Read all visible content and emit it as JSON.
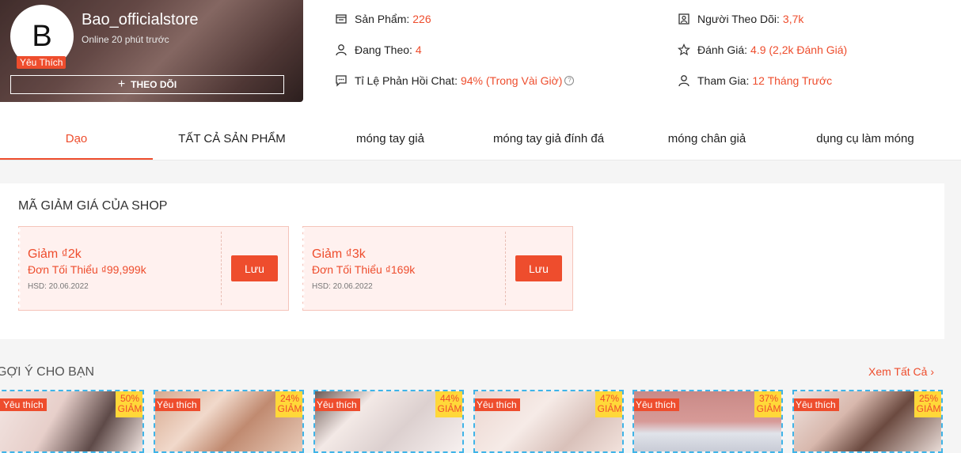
{
  "shop": {
    "avatar_letter": "B",
    "favorite_badge": "Yêu Thích",
    "name": "Bao_officialstore",
    "status": "Online 20 phút trước",
    "follow_label": "THEO DÕI"
  },
  "stats": {
    "products": {
      "label": "Sản Phẩm:",
      "value": "226",
      "icon": "store-icon"
    },
    "followers": {
      "label": "Người Theo Dõi:",
      "value": "3,7k",
      "icon": "followers-icon"
    },
    "following": {
      "label": "Đang Theo:",
      "value": "4",
      "icon": "user-icon"
    },
    "rating": {
      "label": "Đánh Giá:",
      "value": "4.9 (2,2k Đánh Giá)",
      "icon": "star-icon"
    },
    "chat_response": {
      "label": "Tỉ Lệ Phản Hồi Chat:",
      "value": "94% (Trong Vài Giờ)",
      "icon": "chat-icon"
    },
    "joined": {
      "label": "Tham Gia:",
      "value": "12 Tháng Trước",
      "icon": "user-icon"
    }
  },
  "tabs": [
    {
      "label": "Dạo",
      "active": true
    },
    {
      "label": "TẤT CẢ SẢN PHẨM",
      "active": false
    },
    {
      "label": "móng tay giả",
      "active": false
    },
    {
      "label": "móng tay giả đính đá",
      "active": false
    },
    {
      "label": "móng chân giả",
      "active": false
    },
    {
      "label": "dụng cụ làm móng",
      "active": false
    }
  ],
  "vouchers": {
    "title": "MÃ GIẢM GIÁ CỦA SHOP",
    "items": [
      {
        "discount": "Giảm ₫2k",
        "min_order": "Đơn Tối Thiểu ₫99,999k",
        "expiry": "HSD: 20.06.2022",
        "button": "Lưu"
      },
      {
        "discount": "Giảm ₫3k",
        "min_order": "Đơn Tối Thiểu ₫169k",
        "expiry": "HSD: 20.06.2022",
        "button": "Lưu"
      }
    ]
  },
  "recommend": {
    "title": "GỢI Ý CHO BẠN",
    "see_all": "Xem Tất Cả",
    "products": [
      {
        "fav": "Yêu thích",
        "percent": "50%",
        "off": "GIẢM"
      },
      {
        "fav": "Yêu thích",
        "percent": "24%",
        "off": "GIẢM"
      },
      {
        "fav": "Yêu thích",
        "percent": "44%",
        "off": "GIẢM"
      },
      {
        "fav": "Yêu thích",
        "percent": "47%",
        "off": "GIẢM"
      },
      {
        "fav": "Yêu thích",
        "percent": "37%",
        "off": "GIẢM"
      },
      {
        "fav": "Yêu thích",
        "percent": "25%",
        "off": "GIẢM"
      }
    ]
  },
  "colors": {
    "accent": "#ee4d2d",
    "discount_bg": "#ffd839"
  }
}
